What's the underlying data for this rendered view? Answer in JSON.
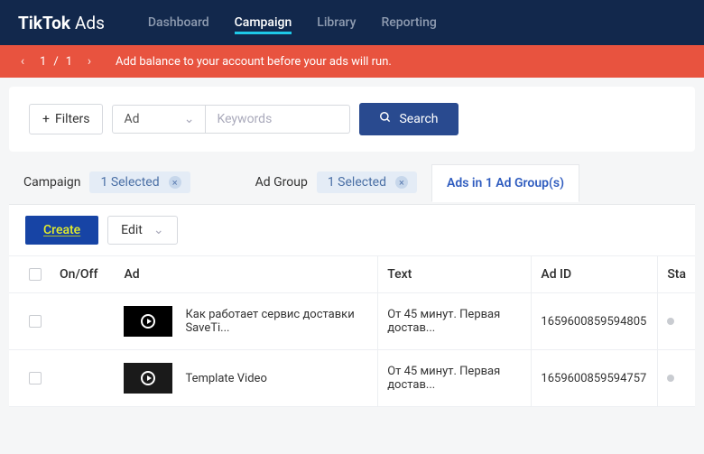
{
  "header": {
    "logo_primary": "TikTok",
    "logo_secondary": "Ads",
    "nav": [
      "Dashboard",
      "Campaign",
      "Library",
      "Reporting"
    ],
    "active_index": 1
  },
  "alert": {
    "current": "1",
    "sep": "/",
    "total": "1",
    "message": "Add balance to your account before your ads will run."
  },
  "toolbar": {
    "filters_label": "Filters",
    "scope_label": "Ad",
    "keywords_placeholder": "Keywords",
    "search_label": "Search"
  },
  "tabs": {
    "campaign": {
      "label": "Campaign",
      "pill": "1 Selected"
    },
    "adgroup": {
      "label": "Ad Group",
      "pill": "1 Selected"
    },
    "ads": {
      "label": "Ads in 1 Ad Group(s)"
    }
  },
  "actions": {
    "create_label": "Create",
    "edit_label": "Edit"
  },
  "columns": {
    "onoff": "On/Off",
    "ad": "Ad",
    "text": "Text",
    "adid": "Ad ID",
    "status": "Sta"
  },
  "rows": [
    {
      "name": "Как работает сервис доставки SaveTi...",
      "text": "От 45 минут. Первая достав...",
      "id": "1659600859594805"
    },
    {
      "name": "Template Video",
      "text": "От 45 минут. Первая достав...",
      "id": "1659600859594757"
    }
  ]
}
